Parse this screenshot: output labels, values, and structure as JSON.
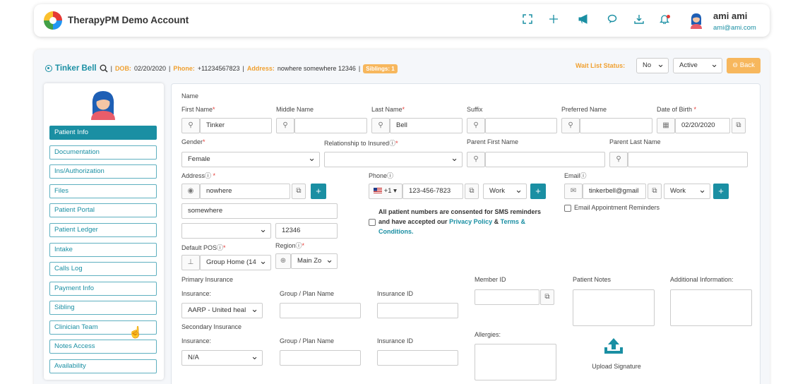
{
  "header": {
    "app_title": "TherapyPM Demo Account",
    "user_name": "ami ami",
    "user_email": "ami@ami.com",
    "icons": [
      "fullscreen-icon",
      "plus-icon",
      "megaphone-icon",
      "chat-icon",
      "download-icon",
      "bell-icon"
    ]
  },
  "patient": {
    "name": "Tinker Bell",
    "sep": "|",
    "dob_label": "DOB:",
    "dob": "02/20/2020",
    "phone_label": "Phone:",
    "phone": "+11234567823",
    "address_label": "Address:",
    "address": "nowhere somewhere 12346",
    "siblings": "Siblings: 1"
  },
  "waitlist": {
    "label": "Wait List Status:",
    "value": "No",
    "status": "Active",
    "back_label": "Back"
  },
  "sidebar": {
    "items": [
      {
        "label": "Patient Info",
        "active": true
      },
      {
        "label": "Documentation"
      },
      {
        "label": "Ins/Authorization"
      },
      {
        "label": "Files"
      },
      {
        "label": "Patient Portal"
      },
      {
        "label": "Patient Ledger"
      },
      {
        "label": "Intake"
      },
      {
        "label": "Calls Log"
      },
      {
        "label": "Payment Info"
      },
      {
        "label": "Sibling"
      },
      {
        "label": "Clinician Team"
      },
      {
        "label": "Notes Access"
      },
      {
        "label": "Availability"
      }
    ]
  },
  "form": {
    "section_name": "Name",
    "first_name_label": "First Name",
    "first_name": "Tinker",
    "middle_name_label": "Middle Name",
    "last_name_label": "Last Name",
    "last_name": "Bell",
    "suffix_label": "Suffix",
    "preferred_name_label": "Preferred Name",
    "dob_label": "Date of Birth",
    "dob": "02/20/2020",
    "gender_label": "Gender",
    "gender": "Female",
    "relationship_label": "Relationship to Insured",
    "parent_first_label": "Parent First Name",
    "parent_last_label": "Parent Last Name",
    "address_label": "Address",
    "address1": "nowhere",
    "address2": "somewhere",
    "zip": "12346",
    "phone_label": "Phone",
    "phone_code": "+1",
    "phone": "123-456-7823",
    "phone_type": "Work",
    "email_label": "Email",
    "email": "tinkerbell@gmail",
    "email_type": "Work",
    "email_reminders": "Email Appointment Reminders",
    "sms_line1": "All patient numbers are consented for SMS reminders",
    "sms_line2": "and have accepted our",
    "privacy_link": "Privacy Policy",
    "amp": "&",
    "terms_link": "Terms &",
    "conditions_link": "Conditions.",
    "pos_label": "Default POS",
    "pos": "Group Home (14",
    "region_label": "Region",
    "region": "Main Zo",
    "primary_ins_title": "Primary Insurance",
    "insurance_label": "Insurance:",
    "primary_insurance": "AARP - United heal",
    "group_plan_label": "Group / Plan Name",
    "insurance_id_label": "Insurance ID",
    "secondary_ins_title": "Secondary Insurance",
    "secondary_insurance": "N/A",
    "member_id_label": "Member ID",
    "patient_notes_label": "Patient Notes",
    "additional_info_label": "Additional Information:",
    "allergies_label": "Allergies:",
    "upload_signature": "Upload Signature"
  },
  "colors": {
    "accent": "#1a8fa3",
    "orange": "#f0a030",
    "badge": "#f7b75d"
  }
}
